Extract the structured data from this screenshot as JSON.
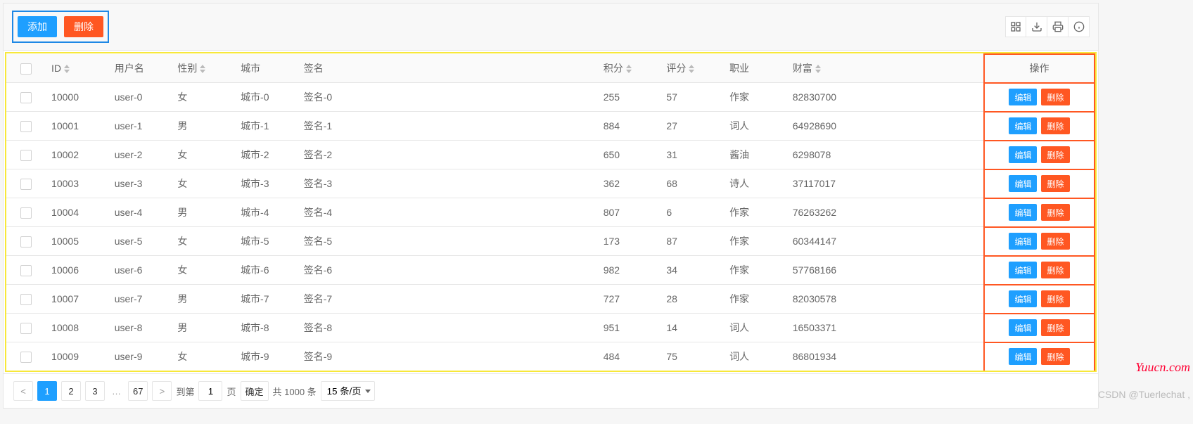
{
  "toolbar": {
    "add_label": "添加",
    "delete_label": "删除"
  },
  "columns": {
    "id": "ID",
    "username": "用户名",
    "sex": "性别",
    "city": "城市",
    "sign": "签名",
    "score": "积分",
    "rating": "评分",
    "job": "职业",
    "wealth": "财富",
    "operate": "操作"
  },
  "row_actions": {
    "edit": "编辑",
    "delete": "删除"
  },
  "rows": [
    {
      "id": "10000",
      "user": "user-0",
      "sex": "女",
      "city": "城市-0",
      "sign": "签名-0",
      "score": "255",
      "rating": "57",
      "job": "作家",
      "wealth": "82830700"
    },
    {
      "id": "10001",
      "user": "user-1",
      "sex": "男",
      "city": "城市-1",
      "sign": "签名-1",
      "score": "884",
      "rating": "27",
      "job": "词人",
      "wealth": "64928690"
    },
    {
      "id": "10002",
      "user": "user-2",
      "sex": "女",
      "city": "城市-2",
      "sign": "签名-2",
      "score": "650",
      "rating": "31",
      "job": "酱油",
      "wealth": "6298078"
    },
    {
      "id": "10003",
      "user": "user-3",
      "sex": "女",
      "city": "城市-3",
      "sign": "签名-3",
      "score": "362",
      "rating": "68",
      "job": "诗人",
      "wealth": "37117017"
    },
    {
      "id": "10004",
      "user": "user-4",
      "sex": "男",
      "city": "城市-4",
      "sign": "签名-4",
      "score": "807",
      "rating": "6",
      "job": "作家",
      "wealth": "76263262"
    },
    {
      "id": "10005",
      "user": "user-5",
      "sex": "女",
      "city": "城市-5",
      "sign": "签名-5",
      "score": "173",
      "rating": "87",
      "job": "作家",
      "wealth": "60344147"
    },
    {
      "id": "10006",
      "user": "user-6",
      "sex": "女",
      "city": "城市-6",
      "sign": "签名-6",
      "score": "982",
      "rating": "34",
      "job": "作家",
      "wealth": "57768166"
    },
    {
      "id": "10007",
      "user": "user-7",
      "sex": "男",
      "city": "城市-7",
      "sign": "签名-7",
      "score": "727",
      "rating": "28",
      "job": "作家",
      "wealth": "82030578"
    },
    {
      "id": "10008",
      "user": "user-8",
      "sex": "男",
      "city": "城市-8",
      "sign": "签名-8",
      "score": "951",
      "rating": "14",
      "job": "词人",
      "wealth": "16503371"
    },
    {
      "id": "10009",
      "user": "user-9",
      "sex": "女",
      "city": "城市-9",
      "sign": "签名-9",
      "score": "484",
      "rating": "75",
      "job": "词人",
      "wealth": "86801934"
    }
  ],
  "pager": {
    "pages": [
      "1",
      "2",
      "3"
    ],
    "last": "67",
    "goto_label": "到第",
    "page_suffix": "页",
    "confirm": "确定",
    "total_label": "共 1000 条",
    "per_page": "15 条/页",
    "current_input": "1"
  },
  "watermarks": {
    "site": "Yuucn.com",
    "author": "CSDN @Tuerlechat ,"
  }
}
